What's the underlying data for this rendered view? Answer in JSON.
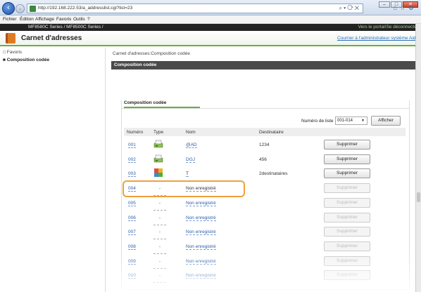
{
  "browser": {
    "url": "http://192.168.222.53/a_addresslist.cgi?list=23",
    "window_buttons": [
      "–",
      "□",
      "✕"
    ],
    "menu": [
      "Fichier",
      "Édition",
      "Affichage",
      "Favoris",
      "Outils",
      "?"
    ]
  },
  "app": {
    "model": "MF8580C Series / MF8500C Series /",
    "portal_link": "Vers le portail",
    "logout_link": "Se déconnecter",
    "title": "Carnet d'adresses",
    "contact_link": "Courrier à l'administrateur système",
    "help_link": "Aide"
  },
  "sidebar": {
    "items": [
      {
        "label": "Favoris",
        "bullet": "□"
      },
      {
        "label": "Composition codée",
        "bullet": "■"
      }
    ]
  },
  "main": {
    "breadcrumb": "Carnet d'adresses:Composition codée",
    "section_title": "Composition codée",
    "panel_title": "Composition codée",
    "list_label": "Numéro de liste :",
    "list_value": "001-014",
    "display_button": "Afficher",
    "columns": [
      "Numéro",
      "Type",
      "Nom",
      "Destinataire"
    ],
    "rows": [
      {
        "num": "001",
        "type": "fax",
        "name": "@AD",
        "dest": "1234",
        "action": "Supprimer",
        "enabled": true,
        "plain": false
      },
      {
        "num": "002",
        "type": "fax",
        "name": "DGJ",
        "dest": "456",
        "action": "Supprimer",
        "enabled": true,
        "plain": false
      },
      {
        "num": "003",
        "type": "group",
        "name": "T",
        "dest": "2destinataires",
        "action": "Supprimer",
        "enabled": true,
        "plain": true
      },
      {
        "num": "004",
        "type": "-",
        "name": "Non enregistré",
        "dest": "",
        "action": "Supprimer",
        "enabled": false,
        "plain": true
      },
      {
        "num": "005",
        "type": "-",
        "name": "Non enregistré",
        "dest": "",
        "action": "Supprimer",
        "enabled": false,
        "plain": false
      },
      {
        "num": "006",
        "type": "-",
        "name": "Non enregistré",
        "dest": "",
        "action": "Supprimer",
        "enabled": false,
        "plain": false
      },
      {
        "num": "007",
        "type": "-",
        "name": "Non enregistré",
        "dest": "",
        "action": "Supprimer",
        "enabled": false,
        "plain": false
      },
      {
        "num": "008",
        "type": "-",
        "name": "Non enregistré",
        "dest": "",
        "action": "Supprimer",
        "enabled": false,
        "plain": false
      },
      {
        "num": "009",
        "type": "-",
        "name": "Non enregistré",
        "dest": "",
        "action": "Supprimer",
        "enabled": false,
        "plain": false
      },
      {
        "num": "010",
        "type": "-",
        "name": "Non enregistré",
        "dest": "",
        "action": "Supprimer",
        "enabled": false,
        "plain": false
      }
    ]
  },
  "colors": {
    "accent_green": "#6cad3c",
    "highlight_orange": "#f0a03c",
    "link_blue": "#2a5da8"
  }
}
